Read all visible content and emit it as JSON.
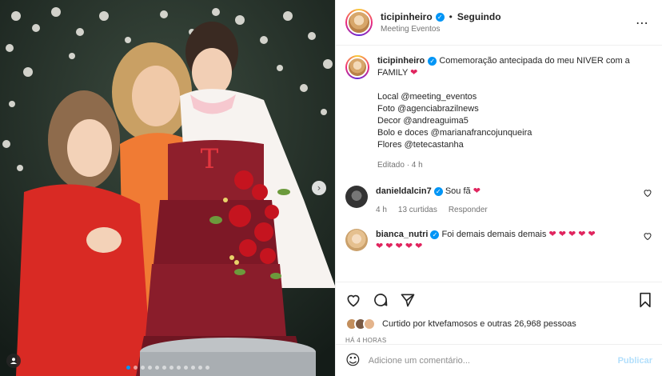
{
  "post": {
    "username": "ticipinheiro",
    "separator": "•",
    "follow_status": "Seguindo",
    "location": "Meeting Eventos",
    "more_icon": "⋯"
  },
  "caption": {
    "username": "ticipinheiro",
    "text_line1": "Comemoração antecipada do meu NIVER com a FAMILY",
    "heart": "❤",
    "credits": [
      "Local @meeting_eventos",
      "Foto @agenciabrazilnews",
      "Decor @andreaguima5",
      "Bolo e doces @marianafrancojunqueira",
      "Flores @tetecastanha"
    ],
    "edited_label": "Editado · 4 h"
  },
  "comments": [
    {
      "username": "danieldalcin7",
      "text": "Sou fã",
      "heart": "❤",
      "time": "4 h",
      "likes": "13 curtidas",
      "reply": "Responder"
    },
    {
      "username": "bianca_nutri",
      "text": "Foi demais demais demais",
      "hearts_inline": "❤ ❤ ❤ ❤ ❤",
      "hearts_line2": "❤ ❤ ❤ ❤ ❤"
    }
  ],
  "likes_text": "Curtido por ktvefamosos e outras 26,968 pessoas",
  "timestamp": "HÁ 4 HORAS",
  "add_comment": {
    "placeholder": "Adicione um comentário...",
    "emoji_icon": "☺",
    "publish_label": "Publicar"
  },
  "carousel": {
    "total_slides": 12,
    "active_index": 0,
    "next_icon": "›"
  },
  "colors": {
    "accent": "#0095f6",
    "heart": "#e0245e",
    "publish_disabled": "#b2dffc"
  }
}
